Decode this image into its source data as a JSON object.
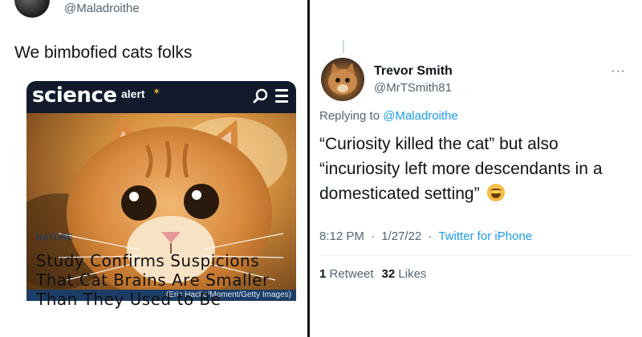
{
  "left_tweet": {
    "handle": "@Maladroithe",
    "text": "We bimbofied cats folks",
    "card": {
      "site_logo": "science",
      "site_logo_suffix": "alert",
      "photo_credit": "(Eric Hacke/Moment/Getty Images)",
      "section": "NATURE",
      "headline": "Study Confirms Suspicions That Cat Brains Are Smaller Than They Used to Be"
    }
  },
  "right_tweet": {
    "name": "Trevor Smith",
    "handle": "@MrTSmith81",
    "more": "···",
    "replying_prefix": "Replying to ",
    "replying_to": "@Maladroithe",
    "text": "“Curiosity killed the cat” but also “incuriosity left more descendants in a domesticated setting”",
    "emoji": "face-with-tears-of-joy",
    "time": "8:12 PM",
    "date": "1/27/22",
    "separator": "·",
    "source": "Twitter for iPhone",
    "retweets_count": "1",
    "retweets_label": "Retweet",
    "likes_count": "32",
    "likes_label": "Likes"
  },
  "colors": {
    "link": "#1d9bf0",
    "muted": "#536471",
    "sa_header": "#101a2b",
    "caption_bar": "#1c3d66"
  }
}
